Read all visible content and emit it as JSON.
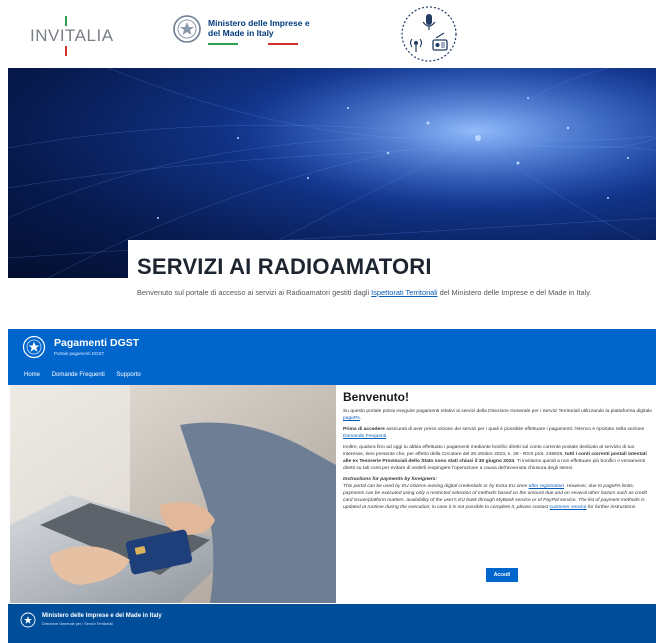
{
  "logos": {
    "invitalia": "INVITALIA",
    "ministry": "Ministero delle Imprese e del Made in Italy",
    "radio_logo_icon": "radio-microphone-icon"
  },
  "hero": {
    "title": "SERVIZI AI RADIOAMATORI",
    "subtitle_before": "Benvenuto sul portale di accesso ai servizi ai Radioamatori gestiti dagli ",
    "subtitle_link": "Ispettorati Territoriali",
    "subtitle_after": " del Ministero delle Imprese e del Made in Italy."
  },
  "portal": {
    "title": "Pagamenti DGST",
    "subtitle": "Portale pagamenti DGST",
    "nav": [
      "Home",
      "Domande Frequenti",
      "Supporto"
    ],
    "welcome": "Benvenuto!",
    "p1_before": "Su questo portale potrai eseguire pagamenti relativi ai servizi della Direzione Generale per i Servizi Territoriali utilizzando la piattaforma digitale ",
    "p1_link": "pagoPA",
    "p1_after": ".",
    "p2_bold": "Prima di accedere",
    "p2_text": " assicurati di aver preso visione dei servizi per i quali è possibile effettuare i pagamenti: l'elenco è riportato nella sezione ",
    "p2_link": "Domande Frequenti",
    "p2_end": ".",
    "p3_text": "Inoltre, qualora fino ad oggi tu abbia effettuato i pagamenti mediante bonifici diretti sul conto corrente postale dedicato al servizio di tuo interesse, tieni presente che, per effetto della Circolare del 26 ottobre 2023, n. 28 - RGS prot. 249626, ",
    "p3_bold": "tutti i conti correnti postali intestati alle ex Tesorerie Provinciali dello Stato sono stati chiusi il 30 giugno 2024",
    "p3_end": ". Ti invitiamo quindi a non effettuare più bonifici o versamenti diretti su tali conti per evitare di vederli respingere l'operazione a causa dell'avvenuta chiusura degli stessi.",
    "p4_heading": "Instructions for payments by foreigners:",
    "p4_before": "This portal can be used by EU citizens owning digital credentials or by Extra EU ones ",
    "p4_link1": "after registration",
    "p4_mid": ". However, due to pagoPA limits, payments can be executed using only a restricted selection of methods based on the amount due and on several other factors such as credit card issuer/platform matters, availability of the user's EU bank through MyBank service or of PayPal service. The list of payment methods is updated at runtime during the execution; in case it is not possible to complete it, please contact ",
    "p4_link2": "customer service",
    "p4_after": " for further instructions.",
    "login_button": "Accedi"
  },
  "footer": {
    "title": "Ministero delle Imprese e del Made in Italy",
    "subtitle": "Direzione Generale per i Servizi Territoriali"
  },
  "colors": {
    "portal_blue": "#0066cc",
    "footer_blue": "#004d99",
    "link_blue": "#0a5db8",
    "hero_dark": "#071a4e"
  }
}
